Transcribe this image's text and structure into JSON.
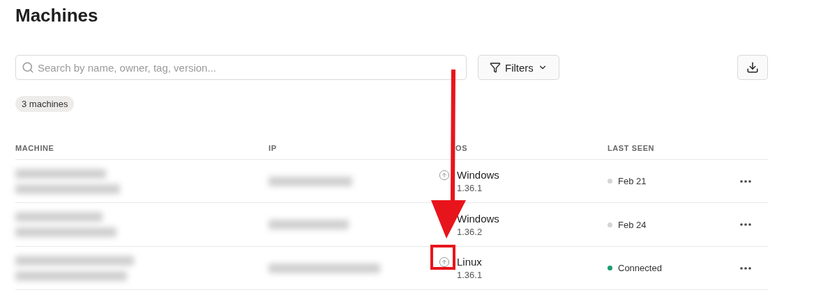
{
  "title": "Machines",
  "search": {
    "placeholder": "Search by name, owner, tag, version..."
  },
  "filters_button": {
    "label": "Filters"
  },
  "count_badge": "3 machines",
  "table": {
    "columns": [
      "MACHINE",
      "IP",
      "OS",
      "LAST SEEN"
    ],
    "rows": [
      {
        "update_available": true,
        "os": "Windows",
        "version": "1.36.1",
        "last_seen": "Feb 21",
        "color": "#d4d4d4"
      },
      {
        "update_available": false,
        "os": "Windows",
        "version": "1.36.2",
        "last_seen": "Feb 24",
        "color": "#d4d4d4"
      },
      {
        "update_available": true,
        "os": "Linux",
        "version": "1.36.1",
        "last_seen": "Connected",
        "color": "#1a9e6e"
      }
    ]
  }
}
